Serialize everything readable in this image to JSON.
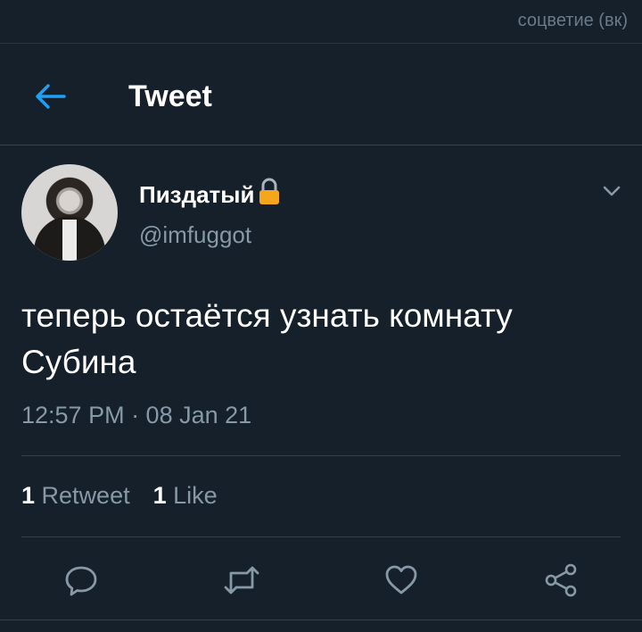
{
  "watermark": "соцветие (вк)",
  "header": {
    "title": "Tweet"
  },
  "tweet": {
    "author_name": "Пиздатый",
    "author_handle": "@imfuggot",
    "text": "теперь остаётся узнать комнату Субина",
    "timestamp": "12:57 PM · 08 Jan 21",
    "retweet_count": "1",
    "retweet_label": "Retweet",
    "like_count": "1",
    "like_label": "Like"
  },
  "colors": {
    "background": "#15202b",
    "accent": "#1da1f2",
    "secondary_text": "#8899a6",
    "divider": "#38444d",
    "lock": "#f4a61d"
  },
  "icons": {
    "back": "arrow-left-icon",
    "lock": "lock-icon",
    "more": "chevron-down-icon",
    "reply": "reply-icon",
    "retweet": "retweet-icon",
    "like": "heart-icon",
    "share": "share-icon"
  }
}
